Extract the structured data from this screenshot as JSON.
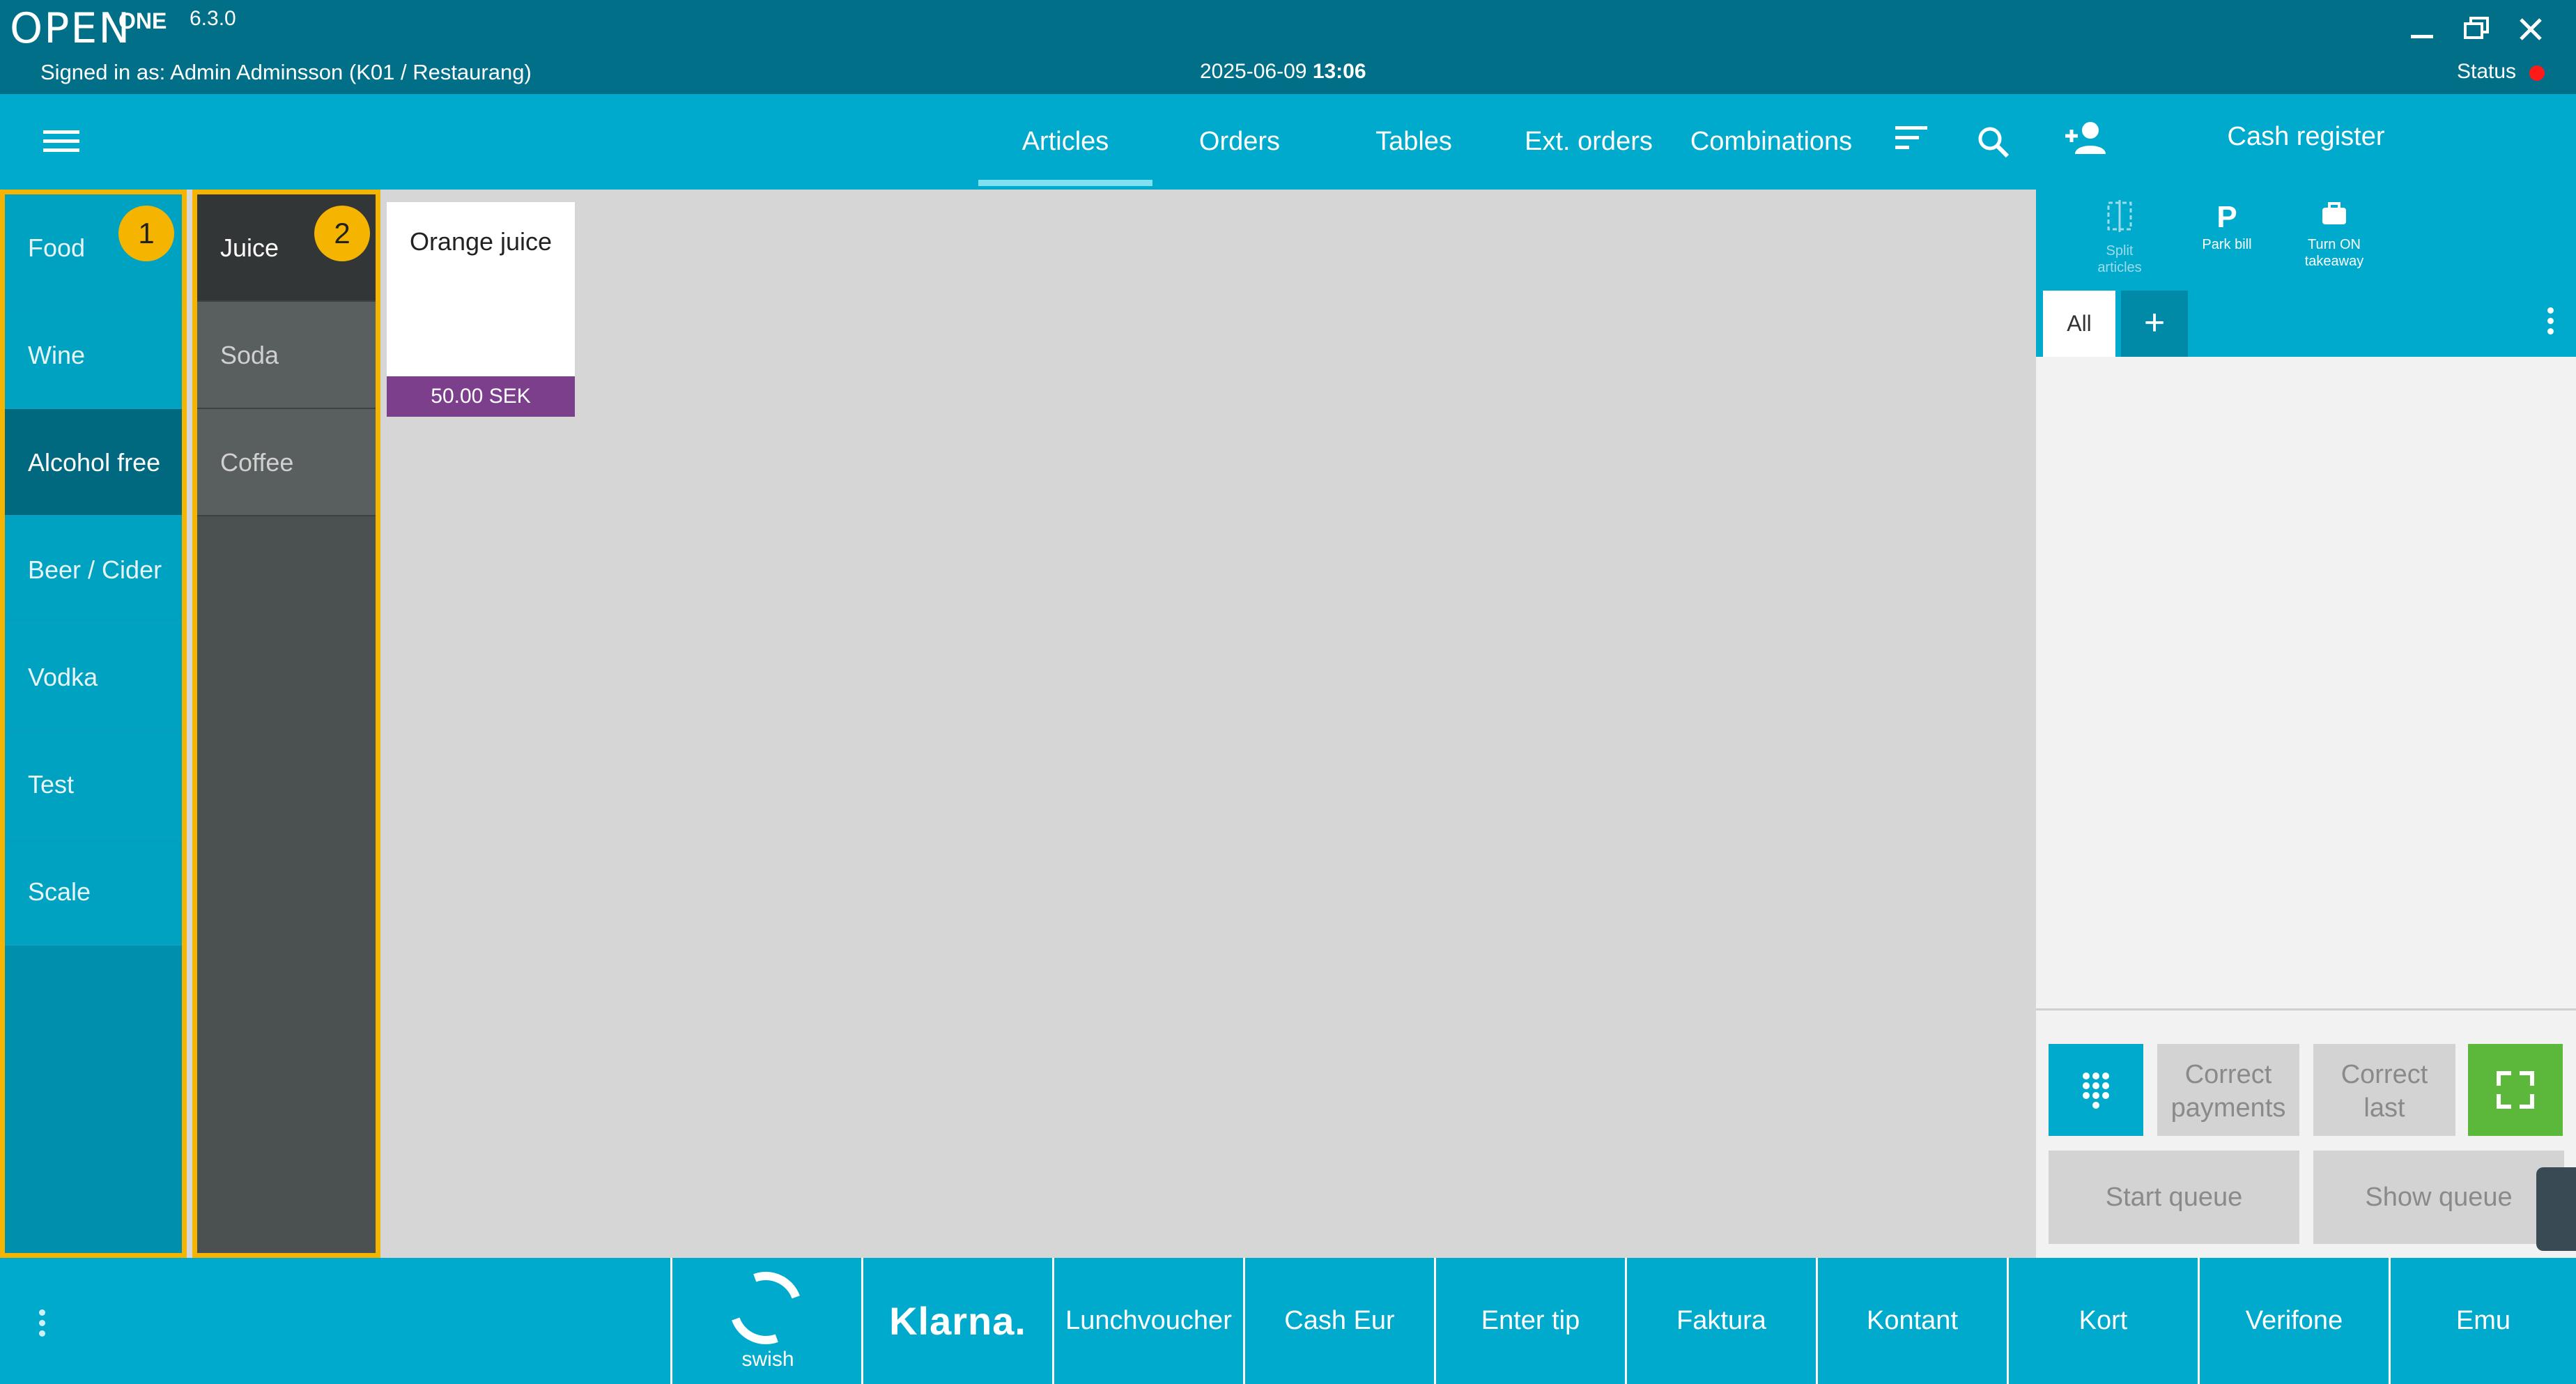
{
  "titlebar": {
    "logo": "OPEN",
    "logo_suffix": "ONE",
    "version": "6.3.0",
    "signed_in": "Signed in as: Admin Adminsson (K01 / Restaurang)",
    "date": "2025-06-09",
    "time": "13:06",
    "status_label": "Status",
    "status_color": "#ff1a1a"
  },
  "nav": {
    "tabs": [
      {
        "label": "Articles"
      },
      {
        "label": "Orders"
      },
      {
        "label": "Tables"
      },
      {
        "label": "Ext. orders"
      },
      {
        "label": "Combinations"
      }
    ],
    "active_tab": "Articles"
  },
  "categories": {
    "items": [
      {
        "label": "Food"
      },
      {
        "label": "Wine"
      },
      {
        "label": "Alcohol free"
      },
      {
        "label": "Beer / Cider"
      },
      {
        "label": "Vodka"
      },
      {
        "label": "Test"
      },
      {
        "label": "Scale"
      }
    ],
    "active": "Alcohol free",
    "badge": "1"
  },
  "subcategories": {
    "items": [
      {
        "label": "Juice"
      },
      {
        "label": "Soda"
      },
      {
        "label": "Coffee"
      }
    ],
    "active": "Juice",
    "badge": "2"
  },
  "articles": [
    {
      "name": "Orange juice",
      "price": "50.00 SEK"
    }
  ],
  "register": {
    "title": "Cash register",
    "tools": {
      "split_line1": "Split",
      "split_line2": "articles",
      "park": "Park bill",
      "takeaway_line1": "Turn ON",
      "takeaway_line2": "takeaway"
    },
    "tab_all": "All",
    "tab_add": "+",
    "buttons": {
      "correct_payments_1": "Correct",
      "correct_payments_2": "payments",
      "correct_last_1": "Correct",
      "correct_last_2": "last",
      "start_queue": "Start queue",
      "show_queue": "Show queue"
    }
  },
  "payment_methods": {
    "swish": "swish",
    "klarna": "Klarna.",
    "lunchvoucher": "Lunchvoucher",
    "cash_eur": "Cash Eur",
    "enter_tip": "Enter tip",
    "faktura": "Faktura",
    "kontant": "Kontant",
    "kort": "Kort",
    "verifone": "Verifone",
    "emu": "Emu"
  },
  "colors": {
    "title_bar": "#006f87",
    "accent": "#00aacc",
    "highlight_border": "#f4b400",
    "price_tag": "#7b3f8c",
    "fullscreen_button": "#5cb83a"
  },
  "icons": [
    "menu-icon",
    "sort-icon",
    "search-icon",
    "add-user-icon",
    "split-icon",
    "parking-icon",
    "briefcase-icon",
    "more-vertical-icon",
    "keypad-icon",
    "fullscreen-icon",
    "minimize-icon",
    "restore-icon",
    "close-icon"
  ]
}
